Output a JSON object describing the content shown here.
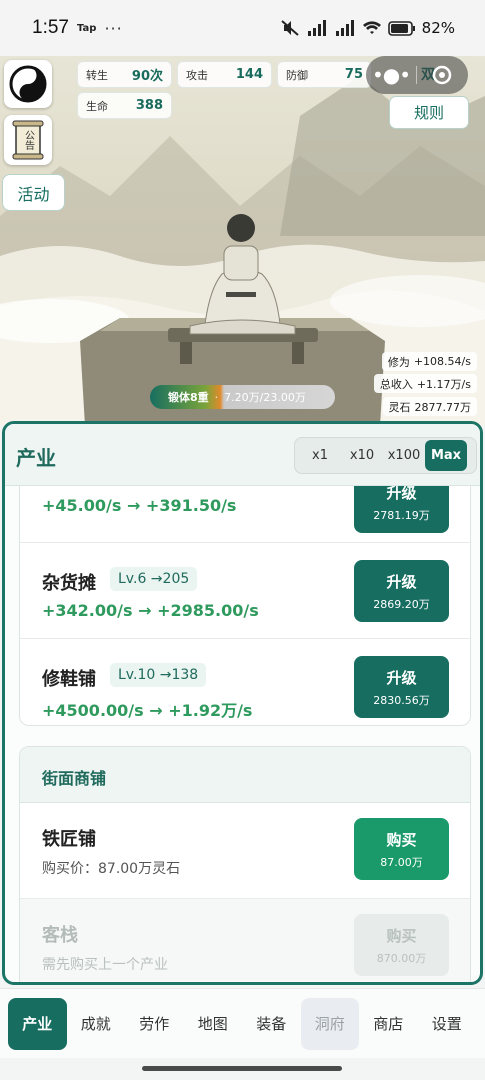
{
  "status_bar": {
    "time": "1:57",
    "app_tag": "Tap",
    "dots": "···",
    "battery": "82%"
  },
  "hero": {
    "activity_label": "活动",
    "notice_text": "公告",
    "rules_label": "规则",
    "dual_label": "双",
    "stats": {
      "rebirth_label": "转生",
      "rebirth_value": "90次",
      "attack_label": "攻击",
      "attack_value": "144",
      "defense_label": "防御",
      "defense_value": "75",
      "hp_label": "生命",
      "hp_value": "388"
    },
    "rates": {
      "cultivation_label": "修为",
      "cultivation_value": "+108.54/s",
      "income_label": "总收入",
      "income_value": "+1.17万/s",
      "stone_label": "灵石",
      "stone_value": "2877.77万"
    },
    "realm": {
      "name": "锻体8重",
      "separator": "·",
      "progress_text": "7.20万/23.00万"
    }
  },
  "industry": {
    "title": "产业",
    "multipliers": [
      "x1",
      "x10",
      "x100",
      "Max"
    ],
    "active_multiplier": "Max",
    "rows": [
      {
        "name": "",
        "level": "",
        "rate": "+45.00/s → +391.50/s",
        "button": "升级",
        "cost": "2781.19万"
      },
      {
        "name": "杂货摊",
        "level": "Lv.6 →205",
        "rate": "+342.00/s → +2985.00/s",
        "button": "升级",
        "cost": "2869.20万"
      },
      {
        "name": "修鞋铺",
        "level": "Lv.10 →138",
        "rate": "+4500.00/s → +1.92万/s",
        "button": "升级",
        "cost": "2830.56万"
      }
    ],
    "shop": {
      "title": "街面商铺",
      "items": [
        {
          "name": "铁匠铺",
          "price": "购买价：87.00万灵石",
          "button": "购买",
          "cost": "87.00万"
        },
        {
          "name": "客栈",
          "price": "需先购买上一个产业",
          "button": "购买",
          "cost": "870.00万"
        }
      ]
    }
  },
  "tabs": [
    "产业",
    "成就",
    "劳作",
    "地图",
    "装备",
    "洞府",
    "商店",
    "设置"
  ],
  "active_tab": "产业",
  "colors": {
    "accent": "#176e60",
    "buy_green": "#1a9a6a",
    "rate_green": "#2f9a5d"
  }
}
